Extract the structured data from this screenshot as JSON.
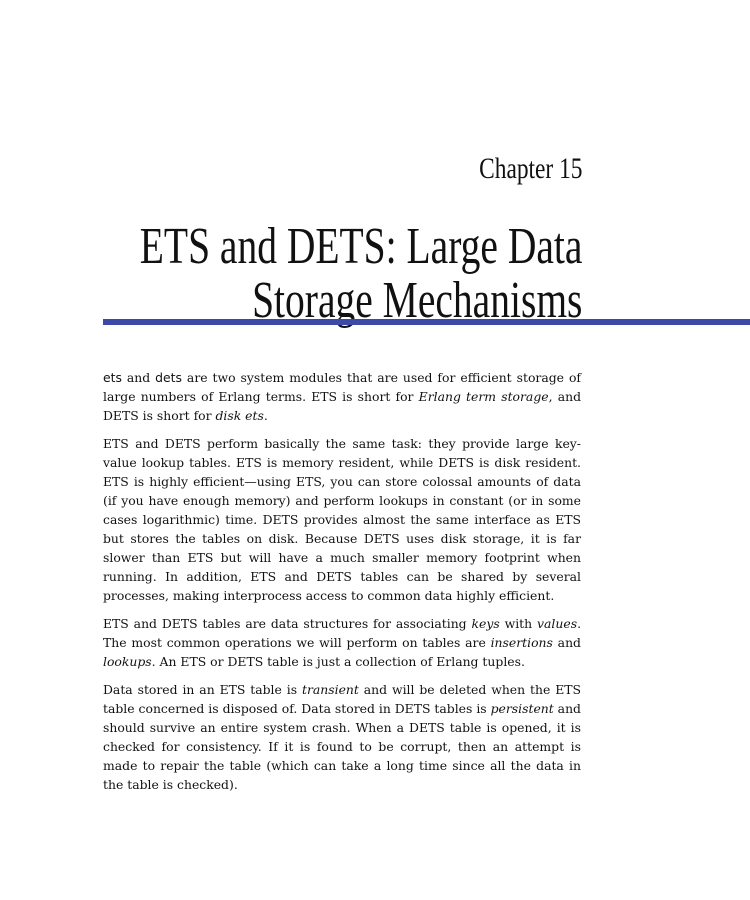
{
  "chapter": {
    "label": "Chapter  15",
    "title_line1": "ETS and DETS: Large Data",
    "title_line2": "Storage Mechanisms",
    "rule_color": "#3b4aa8"
  },
  "paragraphs": {
    "p1": {
      "a": "ets",
      "b": " and ",
      "c": "dets",
      "d": " are two system modules that are used for efficient storage of large numbers of Erlang terms. ETS is short for ",
      "e": "Erlang term storage",
      "f": ", and DETS is short for ",
      "g": "disk ets",
      "h": "."
    },
    "p2": "ETS and DETS perform basically the same task: they provide large key-value lookup tables. ETS is memory resident, while DETS is disk resident. ETS is highly efficient—using ETS, you can store colossal amounts of data (if you have enough memory) and perform lookups in constant (or in some cases logarithmic) time. DETS provides almost the same interface as ETS but stores the tables on disk. Because DETS uses disk storage, it is far slower than ETS but will have a much smaller memory footprint when running. In addition, ETS and DETS tables can be shared by several processes, making interprocess access to common data highly efficient.",
    "p3": {
      "a": "ETS and DETS tables are data structures for associating ",
      "b": "keys",
      "c": " with ",
      "d": "values",
      "e": ". The most common operations we will perform on tables are ",
      "f": "insertions",
      "g": " and ",
      "h": "lookups",
      "i": ". An ETS or DETS table is just a collection of Erlang tuples."
    },
    "p4": {
      "a": "Data stored in an ETS table is ",
      "b": "transient",
      "c": " and will be deleted when the ETS table concerned is disposed of. Data stored in DETS tables is ",
      "d": "persistent",
      "e": " and should survive an entire system crash. When a DETS table is opened, it is checked for consistency. If it is found to be corrupt, then an attempt is made to repair the table (which can take a long time since all the data in the table is checked)."
    }
  }
}
